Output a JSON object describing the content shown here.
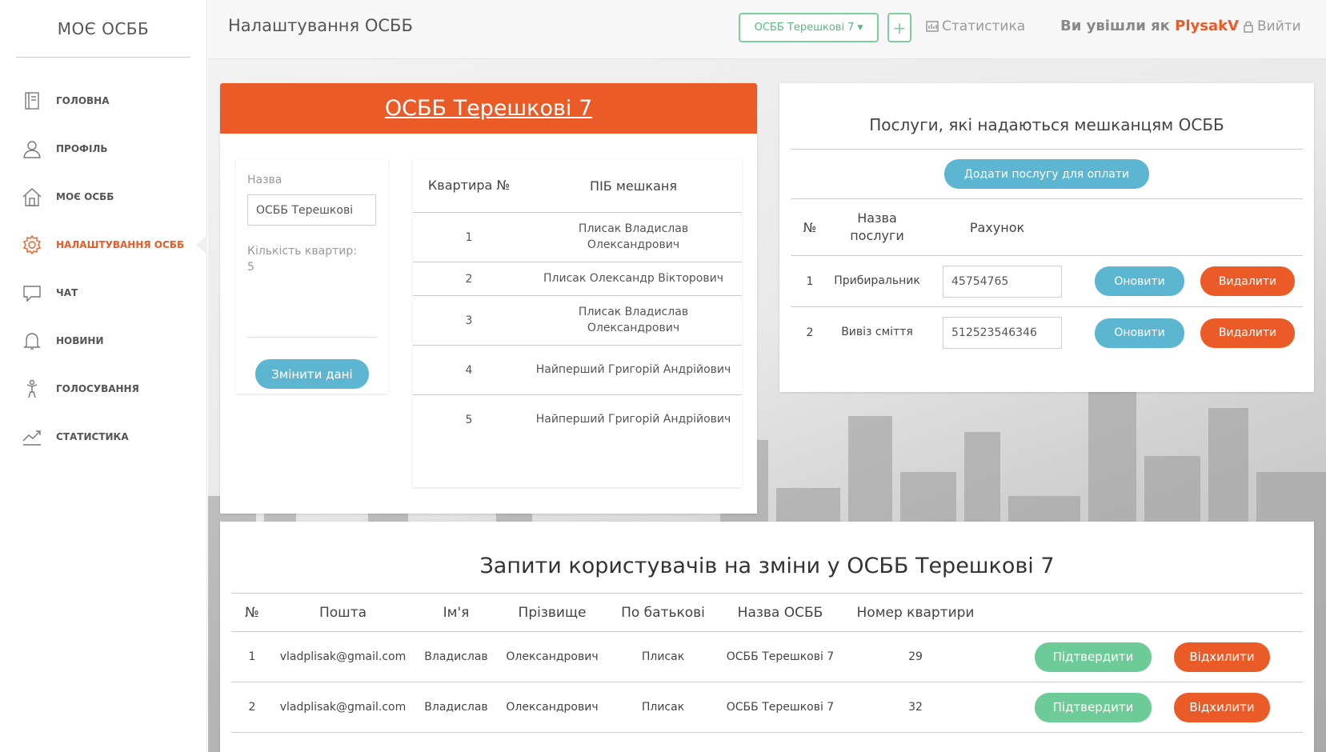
{
  "sidebar": {
    "brand": "МОЄ ОСББ",
    "items": [
      {
        "label": "ГОЛОВНА"
      },
      {
        "label": "ПРОФІЛЬ"
      },
      {
        "label": "МОЄ ОСББ"
      },
      {
        "label": "НАЛАШТУВАННЯ ОСББ",
        "active": true
      },
      {
        "label": "ЧАТ"
      },
      {
        "label": "НОВИНИ"
      },
      {
        "label": "ГОЛОСУВАННЯ"
      },
      {
        "label": "СТАТИСТИКА"
      }
    ]
  },
  "header": {
    "title": "Налаштування ОСББ",
    "osbb_select": "ОСББ Терешкові 7",
    "plus": "+",
    "statistics": "Статистика",
    "logged_prefix": "Ви увішли як",
    "username": "PlysakV",
    "logout": "Вийти"
  },
  "osbb_card": {
    "title": "ОСББ Терешкові 7",
    "name_label": "Назва",
    "name_value": "ОСББ Терешкові",
    "count_label": "Кількість квартир:",
    "count_value": "5",
    "change_button": "Змінити дані",
    "apartments": {
      "header_number": "Квартира №",
      "header_name": "ПІБ мешканя",
      "rows": [
        {
          "number": "1",
          "name": "Плисак Владислав Олександрович"
        },
        {
          "number": "2",
          "name": "Плисак Олександр Вікторович"
        },
        {
          "number": "3",
          "name": "Плисак Владислав Олександрович"
        },
        {
          "number": "4",
          "name": "Найперший Григорій Андрійович"
        },
        {
          "number": "5",
          "name": "Найперший Григорій Андрійович"
        }
      ]
    }
  },
  "services_card": {
    "title": "Послуги, які надаються мешканцям ОСББ",
    "add_button": "Додати послугу для оплати",
    "headers": {
      "number": "№",
      "name": "Назва послуги",
      "account": "Рахунок"
    },
    "rows": [
      {
        "number": "1",
        "name": "Прибиральник",
        "account": "45754765",
        "update": "Оновити",
        "delete": "Видалити"
      },
      {
        "number": "2",
        "name": "Вивіз сміття",
        "account": "512523546346",
        "update": "Оновити",
        "delete": "Видалити"
      }
    ]
  },
  "requests_card": {
    "title": "Запити користувачів на зміни у ОСББ Терешкові 7",
    "headers": {
      "number": "№",
      "email": "Пошта",
      "first_name": "Ім'я",
      "last_name": "Прізвище",
      "patronymic": "По батькові",
      "osbb_name": "Назва ОСББ",
      "apartment": "Номер квартири"
    },
    "rows": [
      {
        "number": "1",
        "email": "vladplisak@gmail.com",
        "first_name": "Владислав",
        "last_name": "Олександрович",
        "patronymic": "Плисак",
        "osbb_name": "ОСББ Терешкові 7",
        "apartment": "29",
        "confirm": "Підтвердити",
        "reject": "Відхилити"
      },
      {
        "number": "2",
        "email": "vladplisak@gmail.com",
        "first_name": "Владислав",
        "last_name": "Олександрович",
        "patronymic": "Плисак",
        "osbb_name": "ОСББ Терешкові 7",
        "apartment": "32",
        "confirm": "Підтвердити",
        "reject": "Відхилити"
      }
    ]
  },
  "colors": {
    "accent": "#eb5b28",
    "blue": "#5db6d1",
    "green": "#6ccb97"
  }
}
